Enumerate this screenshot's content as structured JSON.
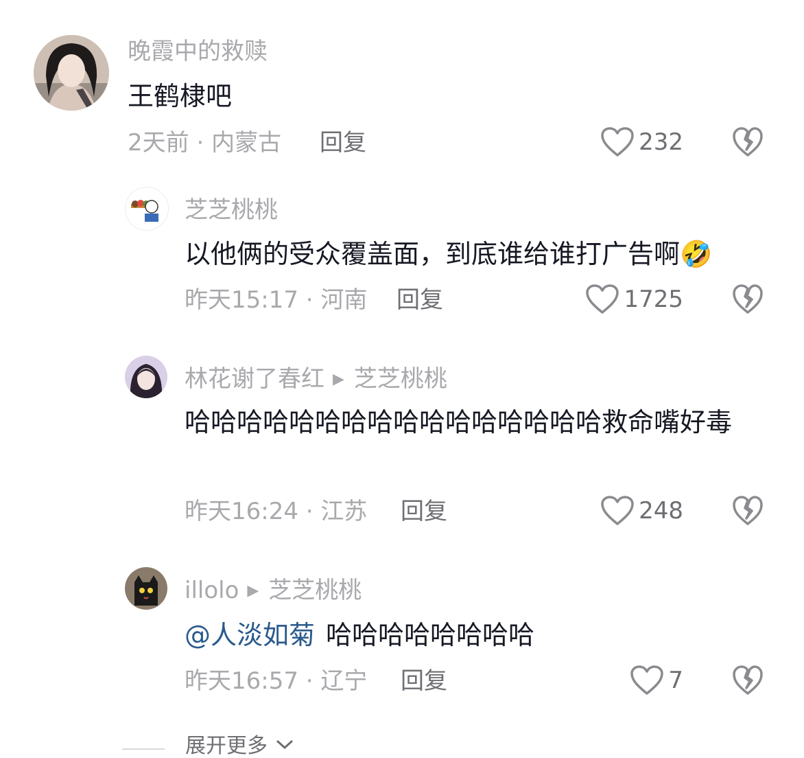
{
  "comments": [
    {
      "username": "晚霞中的救赎",
      "text": "王鹤棣吧",
      "time": "2天前",
      "location": "内蒙古",
      "reply_label": "回复",
      "likes": "232",
      "avatar_icon": "user-photo-avatar"
    }
  ],
  "replies": [
    {
      "username": "芝芝桃桃",
      "text": "以他俩的受众覆盖面，到底谁给谁打广告啊",
      "emoji": "🤣",
      "time": "昨天15:17",
      "location": "河南",
      "reply_label": "回复",
      "likes": "1725",
      "avatar_icon": "cartoon-avatar"
    },
    {
      "username": "林花谢了春红",
      "reply_to": "芝芝桃桃",
      "text": "哈哈哈哈哈哈哈哈哈哈哈哈哈哈哈哈救命嘴好毒",
      "time": "昨天16:24",
      "location": "江苏",
      "reply_label": "回复",
      "likes": "248",
      "avatar_icon": "anime-girl-avatar"
    },
    {
      "username": "illolo",
      "reply_to": "芝芝桃桃",
      "mention": "@人淡如菊",
      "text": "哈哈哈哈哈哈哈哈",
      "time": "昨天16:57",
      "location": "辽宁",
      "reply_label": "回复",
      "likes": "7",
      "avatar_icon": "black-cat-avatar"
    }
  ],
  "expand_more": "展开更多",
  "meta_separator": " · "
}
